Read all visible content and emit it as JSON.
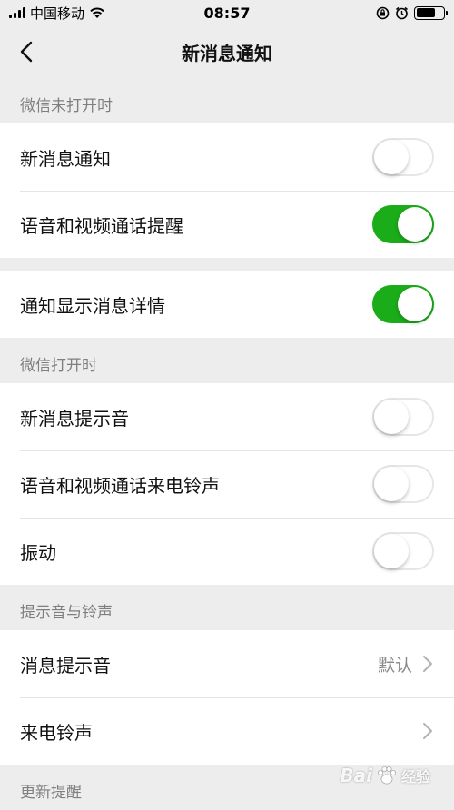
{
  "status_bar": {
    "carrier": "中国移动",
    "time": "08:57"
  },
  "nav": {
    "title": "新消息通知"
  },
  "sections": {
    "wechat_closed": "微信未打开时",
    "wechat_open": "微信打开时",
    "sounds": "提示音与铃声",
    "update": "更新提醒"
  },
  "rows": {
    "new_message_notification": {
      "label": "新消息通知",
      "enabled": false
    },
    "voice_video_call_reminder": {
      "label": "语音和视频通话提醒",
      "enabled": true
    },
    "show_message_details": {
      "label": "通知显示消息详情",
      "enabled": true
    },
    "new_message_sound": {
      "label": "新消息提示音",
      "enabled": false
    },
    "voice_video_ringtone": {
      "label": "语音和视频通话来电铃声",
      "enabled": false
    },
    "vibrate": {
      "label": "振动",
      "enabled": false
    },
    "message_sound": {
      "label": "消息提示音",
      "value": "默认"
    },
    "call_ringtone": {
      "label": "来电铃声"
    }
  },
  "watermark": {
    "text": "Bai",
    "suffix": "经验"
  },
  "colors": {
    "toggle_on": "#1aad19",
    "background": "#ededed",
    "section_text": "#7f7f7f"
  }
}
